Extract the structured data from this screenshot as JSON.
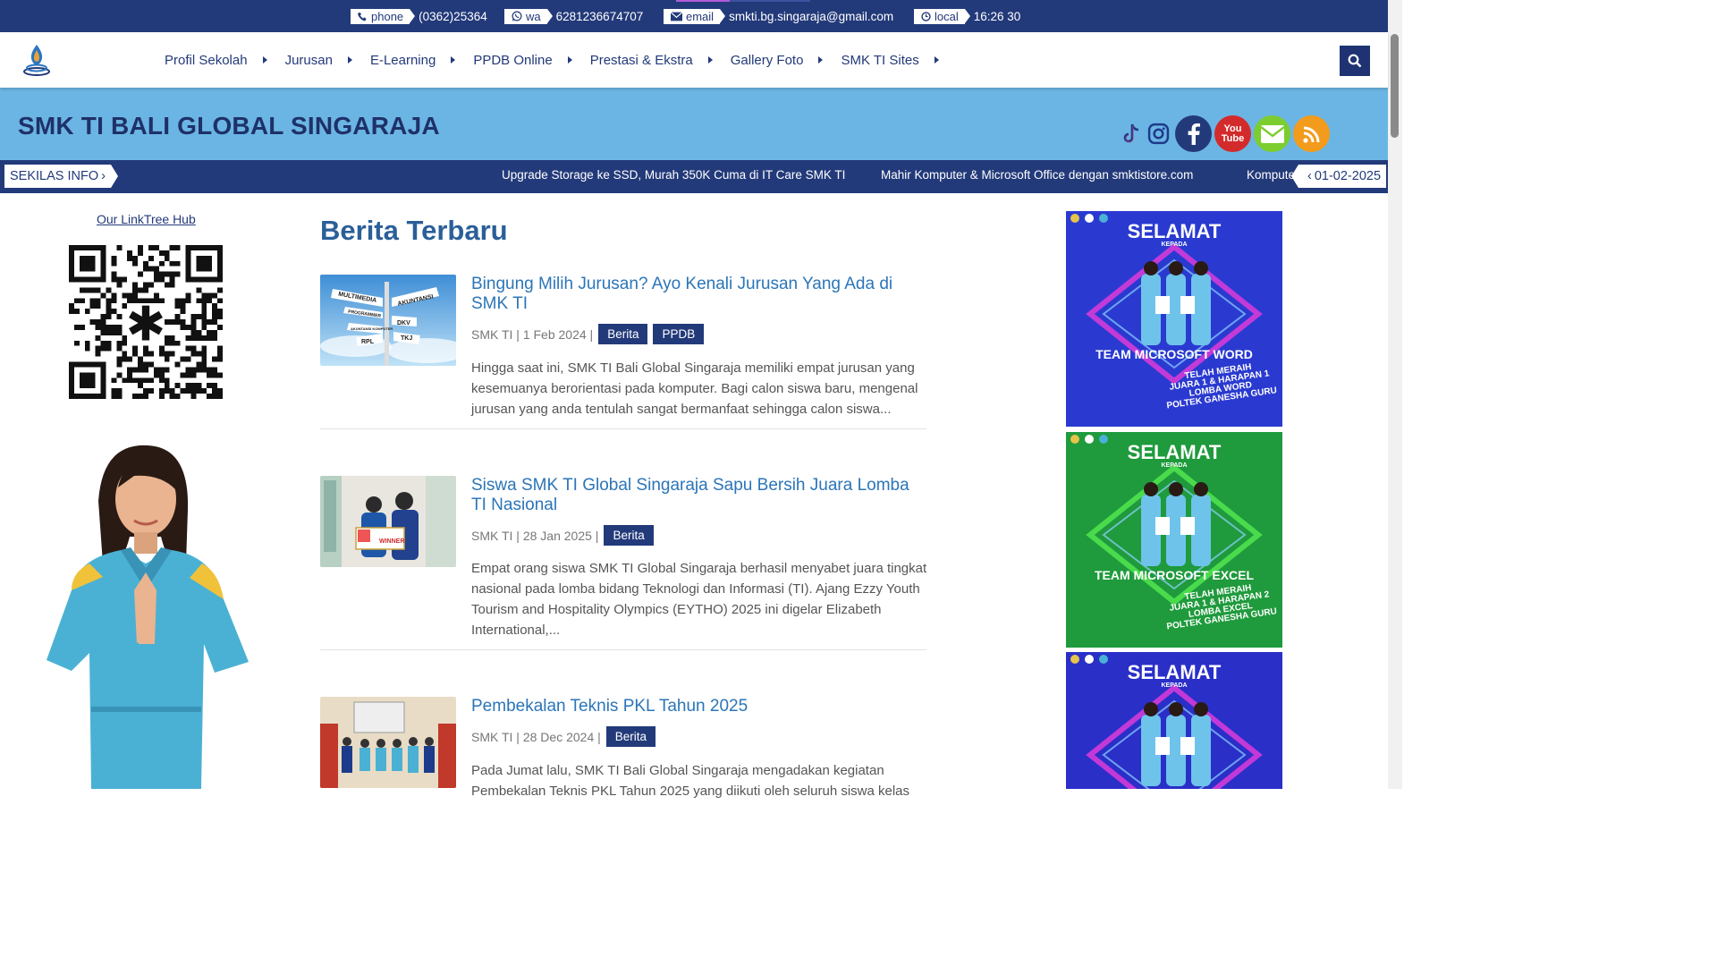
{
  "topbar": {
    "phone": {
      "label": "phone",
      "value": "(0362)25364",
      "icon": "phone-icon"
    },
    "wa": {
      "label": "wa",
      "value": "6281236674707",
      "icon": "whatsapp-icon"
    },
    "email": {
      "label": "email",
      "value": "smkti.bg.singaraja@gmail.com",
      "icon": "envelope-icon"
    },
    "local": {
      "label": "local",
      "value": "16:26 30",
      "icon": "clock-icon"
    }
  },
  "nav": {
    "items": [
      {
        "label": "Profil Sekolah"
      },
      {
        "label": "Jurusan"
      },
      {
        "label": "E-Learning"
      },
      {
        "label": "PPDB Online"
      },
      {
        "label": "Prestasi & Ekstra"
      },
      {
        "label": "Gallery Foto"
      },
      {
        "label": "SMK TI Sites"
      }
    ]
  },
  "banner": {
    "title": "SMK TI BALI GLOBAL SINGARAJA",
    "socials": [
      "tiktok-icon",
      "instagram-icon",
      "facebook-icon",
      "youtube-icon",
      "email-icon",
      "rss-icon"
    ],
    "youtube_text": "You Tube"
  },
  "ticker": {
    "label": "SEKILAS INFO",
    "items": [
      "Upgrade Storage ke SSD, Murah 350K Cuma di IT Care SMK TI",
      "Mahir Komputer & Microsoft Office dengan smktistore.com",
      "Komputer"
    ],
    "date": "01-02-2025"
  },
  "sidebar_left": {
    "linktree": "Our LinkTree Hub"
  },
  "news": {
    "section_title": "Berita Terbaru",
    "posts": [
      {
        "title": "Bingung Milih Jurusan? Ayo Kenali Jurusan Yang Ada di SMK TI",
        "meta": "SMK TI | 1 Feb 2024 |",
        "tags": [
          "Berita",
          "PPDB"
        ],
        "excerpt": "Hingga saat ini, SMK TI Bali Global Singaraja memiliki empat jurusan yang kesemuanya berorientasi pada komputer. Bagi calon siswa baru, mengenal jurusan yang anda tentulah sangat bermanfaat sehingga calon siswa...",
        "signs": [
          "MULTIMEDIA",
          "AKUNTANSI",
          "PROGRAMMER",
          "DKV",
          "AKUNTANSI KOMPUTER",
          "RPL",
          "TKJ"
        ]
      },
      {
        "title": "Siswa SMK TI Global Singaraja Sapu Bersih Juara Lomba TI Nasional",
        "meta": "SMK TI | 28 Jan 2025 |",
        "tags": [
          "Berita"
        ],
        "excerpt": "Empat orang siswa SMK TI Global Singaraja berhasil menyabet juara tingkat nasional pada lomba bidang Teknologi dan Informasi (TI). Ajang Ezzy Youth Tourism and Hospitality Olympics (EYTHO) 2025 ini digelar Elizabeth International,...",
        "sign": "WINNER"
      },
      {
        "title": "Pembekalan Teknis PKL Tahun 2025",
        "meta": "SMK TI | 28 Dec 2024 |",
        "tags": [
          "Berita"
        ],
        "excerpt": "Pada Jumat lalu, SMK TI Bali Global Singaraja mengadakan kegiatan Pembekalan Teknis PKL Tahun 2025 yang diikuti oleh seluruh siswa kelas"
      }
    ]
  },
  "promos": [
    {
      "title": "SELAMAT",
      "sub": "KEPADA",
      "team": "TEAM MICROSOFT WORD",
      "result": [
        "TELAH MERAIH",
        "JUARA 1 & HARAPAN 1",
        "LOMBA WORD",
        "POLTEK GANESHA GURU"
      ],
      "bg": "#2a3ad0",
      "accent": "#d43bd8"
    },
    {
      "title": "SELAMAT",
      "sub": "KEPADA",
      "team": "TEAM MICROSOFT EXCEL",
      "result": [
        "TELAH MERAIH",
        "JUARA 1 & HARAPAN 2",
        "LOMBA EXCEL",
        "POLTEK GANESHA GURU"
      ],
      "bg": "#1f9a3c",
      "accent": "#4fe24f"
    },
    {
      "title": "SELAMAT",
      "sub": "KEPADA",
      "bg": "#2a2fc8",
      "accent": "#d43bd8"
    }
  ],
  "colors": {
    "navy": "#233a7a",
    "banner": "#6bb5e4",
    "link": "#2b75b8",
    "heading": "#2a5f98"
  }
}
